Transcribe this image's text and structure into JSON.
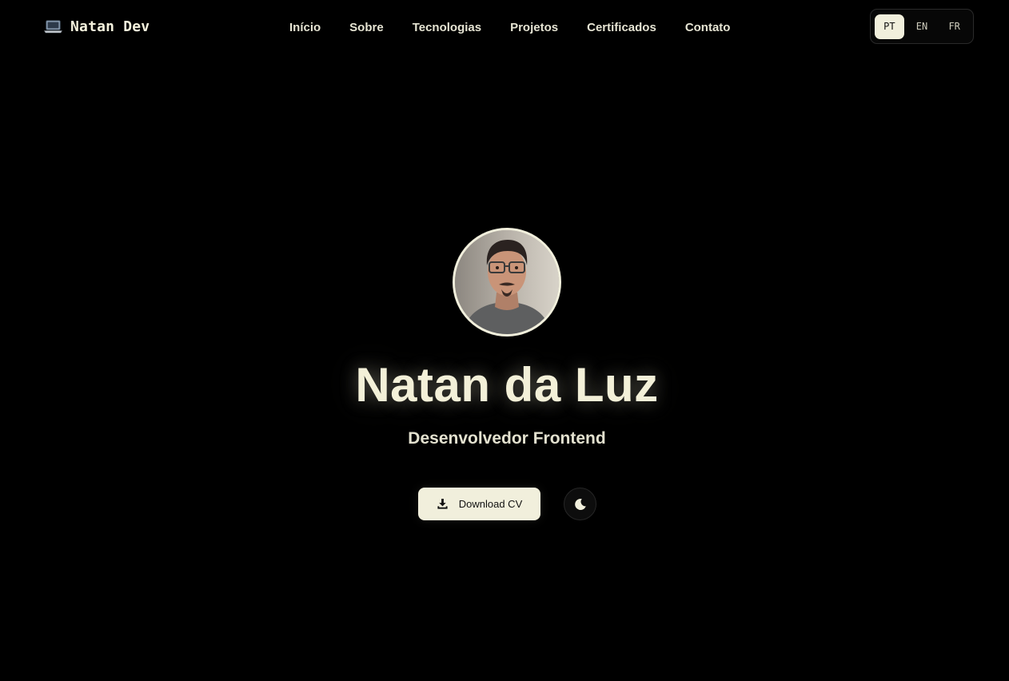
{
  "header": {
    "brand": {
      "icon": "laptop-icon",
      "text": "Natan Dev"
    },
    "nav": [
      {
        "label": "Início"
      },
      {
        "label": "Sobre"
      },
      {
        "label": "Tecnologias"
      },
      {
        "label": "Projetos"
      },
      {
        "label": "Certificados"
      },
      {
        "label": "Contato"
      }
    ],
    "languages": [
      {
        "code": "PT",
        "active": true
      },
      {
        "code": "EN",
        "active": false
      },
      {
        "code": "FR",
        "active": false
      }
    ]
  },
  "hero": {
    "avatar": "profile-photo",
    "name": "Natan da Luz",
    "role": "Desenvolvedor Frontend",
    "download_label": "Download CV",
    "download_icon": "download-icon",
    "theme_toggle_icon": "moon-icon"
  },
  "colors": {
    "background": "#000000",
    "accent": "#f1efdc",
    "text_muted": "#e6e4d3"
  }
}
